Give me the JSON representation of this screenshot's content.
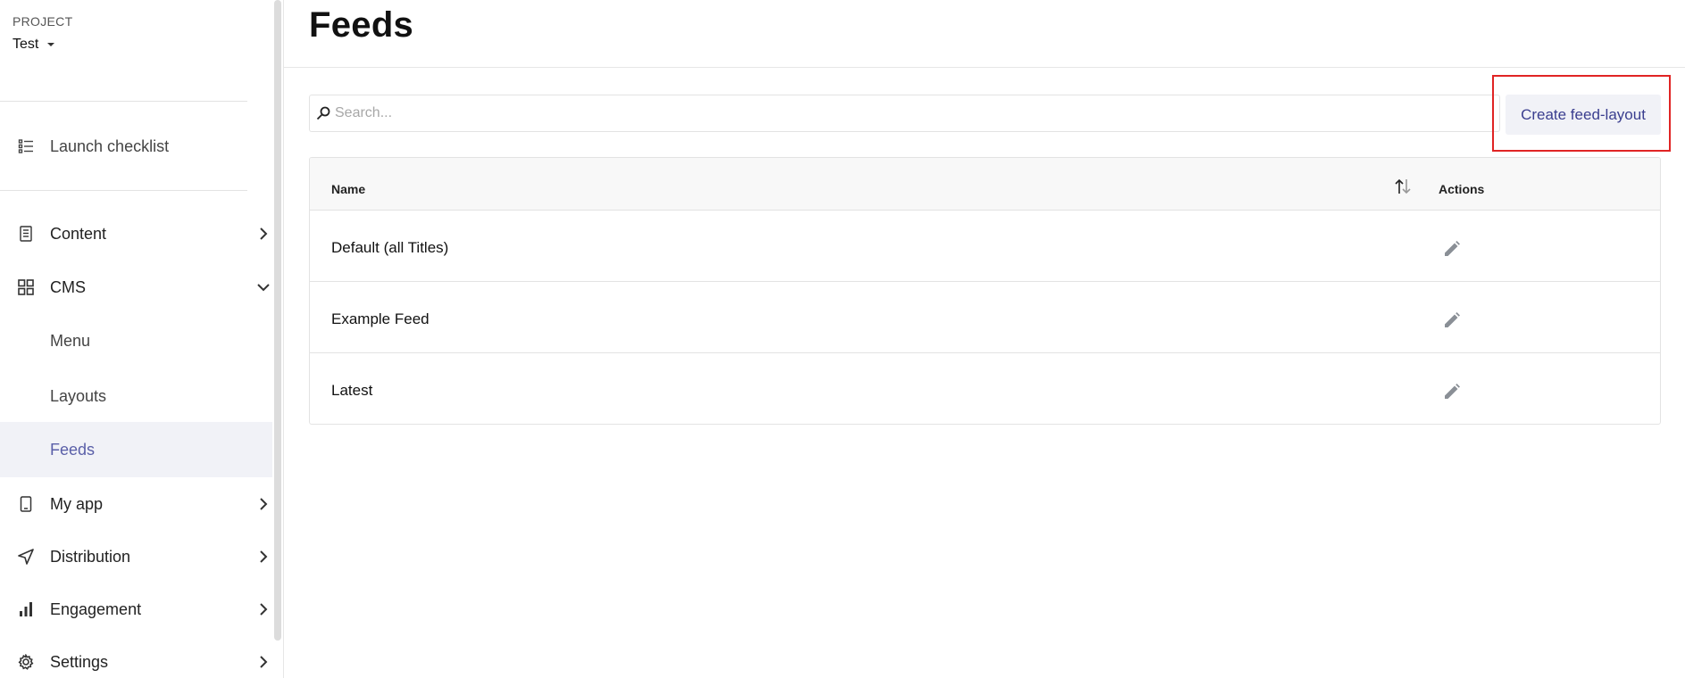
{
  "sidebar": {
    "project_label": "PROJECT",
    "project_name": "Test",
    "launch_checklist": "Launch checklist",
    "items": [
      {
        "label": "Content",
        "icon": "document-icon"
      },
      {
        "label": "CMS",
        "icon": "grid-icon"
      },
      {
        "label": "Menu"
      },
      {
        "label": "Layouts"
      },
      {
        "label": "Feeds"
      },
      {
        "label": "My app",
        "icon": "phone-icon"
      },
      {
        "label": "Distribution",
        "icon": "navigation-arrow-icon"
      },
      {
        "label": "Engagement",
        "icon": "bar-chart-icon"
      },
      {
        "label": "Settings",
        "icon": "gear-icon"
      }
    ]
  },
  "main": {
    "title": "Feeds",
    "search_placeholder": "Search...",
    "create_button": "Create feed-layout",
    "table": {
      "columns": [
        "Name",
        "Actions"
      ],
      "rows": [
        {
          "name": "Default (all Titles)"
        },
        {
          "name": "Example Feed"
        },
        {
          "name": "Latest"
        }
      ]
    }
  },
  "colors": {
    "accent": "#5a5fa8",
    "button_text": "#3a3e8f",
    "button_bg": "#f1f2f7",
    "highlight": "#e02424"
  }
}
